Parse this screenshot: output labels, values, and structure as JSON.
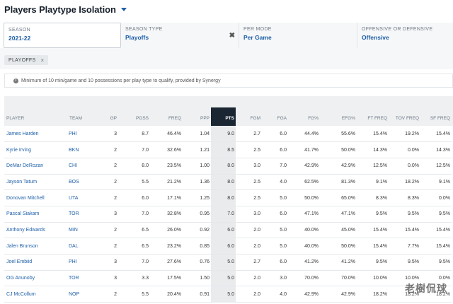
{
  "header": {
    "title": "Players Playtype Isolation"
  },
  "filters": [
    {
      "label": "SEASON",
      "value": "2021-22"
    },
    {
      "label": "SEASON TYPE",
      "value": "Playoffs"
    },
    {
      "label": "PER MODE",
      "value": "Per Game"
    },
    {
      "label": "OFFENSIVE OR DEFENSIVE",
      "value": "Offensive"
    }
  ],
  "clear_symbol": "✖",
  "chip": {
    "label": "PLAYOFFS",
    "close": "×"
  },
  "notice": {
    "icon": "i",
    "text": "Minimum of 10 min/game and 10 possessions per play type to qualify, provided by Synergy"
  },
  "table": {
    "columns": [
      "PLAYER",
      "TEAM",
      "GP",
      "POSS",
      "FREQ",
      "PPP",
      "PTS",
      "FGM",
      "FGA",
      "FG%",
      "EFG%",
      "FT FREQ",
      "TOV FREQ",
      "SF FREQ"
    ],
    "sorted_column": "PTS",
    "rows": [
      [
        "James Harden",
        "PHI",
        "3",
        "8.7",
        "46.4%",
        "1.04",
        "9.0",
        "2.7",
        "6.0",
        "44.4%",
        "55.6%",
        "15.4%",
        "19.2%",
        "15.4%"
      ],
      [
        "Kyrie Irving",
        "BKN",
        "2",
        "7.0",
        "32.6%",
        "1.21",
        "8.5",
        "2.5",
        "6.0",
        "41.7%",
        "50.0%",
        "14.3%",
        "0.0%",
        "14.3%"
      ],
      [
        "DeMar DeRozan",
        "CHI",
        "2",
        "8.0",
        "23.5%",
        "1.00",
        "8.0",
        "3.0",
        "7.0",
        "42.9%",
        "42.9%",
        "12.5%",
        "0.0%",
        "12.5%"
      ],
      [
        "Jayson Tatum",
        "BOS",
        "2",
        "5.5",
        "21.2%",
        "1.36",
        "8.0",
        "2.5",
        "4.0",
        "62.5%",
        "81.3%",
        "9.1%",
        "18.2%",
        "9.1%"
      ],
      [
        "Donovan Mitchell",
        "UTA",
        "2",
        "6.0",
        "17.1%",
        "1.25",
        "8.0",
        "2.5",
        "5.0",
        "50.0%",
        "65.0%",
        "8.3%",
        "8.3%",
        "0.0%"
      ],
      [
        "Pascal Siakam",
        "TOR",
        "3",
        "7.0",
        "32.8%",
        "0.95",
        "7.0",
        "3.0",
        "6.0",
        "47.1%",
        "47.1%",
        "9.5%",
        "9.5%",
        "9.5%"
      ],
      [
        "Anthony Edwards",
        "MIN",
        "2",
        "6.5",
        "26.0%",
        "0.92",
        "6.0",
        "2.0",
        "5.0",
        "40.0%",
        "45.0%",
        "15.4%",
        "15.4%",
        "15.4%"
      ],
      [
        "Jalen Brunson",
        "DAL",
        "2",
        "6.5",
        "23.2%",
        "0.85",
        "6.0",
        "2.0",
        "5.0",
        "40.0%",
        "50.0%",
        "15.4%",
        "7.7%",
        "15.4%"
      ],
      [
        "Joel Embiid",
        "PHI",
        "3",
        "7.0",
        "27.6%",
        "0.76",
        "5.0",
        "2.7",
        "6.0",
        "41.2%",
        "41.2%",
        "9.5%",
        "9.5%",
        "9.5%"
      ],
      [
        "OG Anunoby",
        "TOR",
        "3",
        "3.3",
        "17.5%",
        "1.50",
        "5.0",
        "2.0",
        "3.0",
        "70.0%",
        "70.0%",
        "10.0%",
        "10.0%",
        "0.0%"
      ],
      [
        "CJ McCollum",
        "NOP",
        "2",
        "5.5",
        "20.4%",
        "0.91",
        "5.0",
        "2.0",
        "4.0",
        "42.9%",
        "42.9%",
        "18.2%",
        "18.2%",
        "18.2%"
      ]
    ]
  },
  "watermark": "老樹侃球",
  "colors": {
    "link": "#1d5fa8",
    "sorted_header": "#1b2633",
    "sorted_cell": "#e9ebed"
  }
}
